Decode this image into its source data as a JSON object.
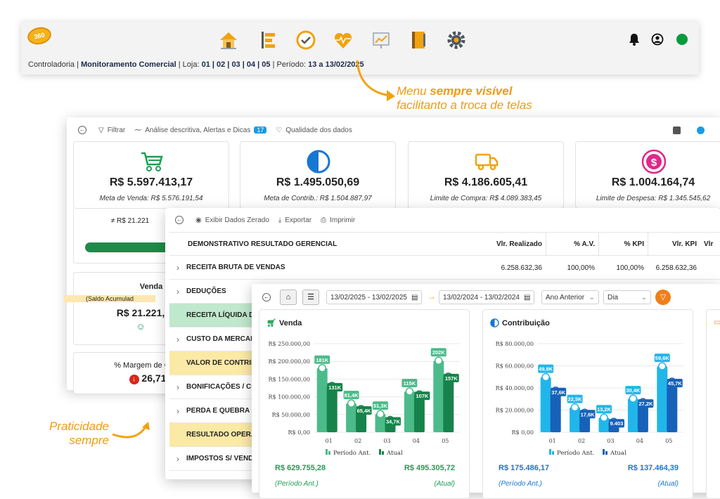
{
  "topbar": {
    "logo_text": "360",
    "breadcrumb": {
      "p1": "Controladoria | ",
      "p2": "Monitoramento Comercial",
      "p3": " | Loja: ",
      "p4": "01 | 02 | 03 | 04 | 05",
      "p5": " | Período: ",
      "p6": "13 a 13/02/2025"
    },
    "icons": [
      "home-icon",
      "list-icon",
      "check-circle-icon",
      "heart-pulse-icon",
      "chart-board-icon",
      "notebook-icon",
      "gear-icon"
    ],
    "right_icons": [
      "bell-icon",
      "user-circle-icon",
      "status-dot-icon"
    ],
    "status_color": "#0a9a3e"
  },
  "callouts": {
    "menu_l1a": "Menu ",
    "menu_l1b": "sempre visível",
    "menu_l2": "facilitanto a troca de telas",
    "prat_l1": "Praticidade",
    "prat_l2": "sempre"
  },
  "panel1": {
    "toolbar": {
      "filter": "Filtrar",
      "analysis": "Análise descritiva, Alertas e Dicas",
      "analysis_badge": "17",
      "quality": "Qualidade dos dados"
    },
    "kpis": [
      {
        "value": "R$ 5.597.413,17",
        "meta": "Meta de Venda: R$ 5.576.191,54",
        "icon": "cart-icon",
        "color": "#1e9e55"
      },
      {
        "value": "R$ 1.495.050,69",
        "meta": "Meta de Contrib.: R$ 1.504.887,97",
        "icon": "half-circle-icon",
        "color": "#1877d2"
      },
      {
        "value": "R$ 4.186.605,41",
        "meta": "Limite de Compra: R$ 4.089.383,45",
        "icon": "truck-icon",
        "color": "#f2a20f"
      },
      {
        "value": "R$ 1.004.164,74",
        "meta": "Limite de Despesa: R$ 1.345.545,62",
        "icon": "dollar-coin-icon",
        "color": "#e0288a"
      }
    ],
    "diff": "≠ R$ 21.221",
    "venda": {
      "title": "Venda",
      "saldo": "(Saldo Acumulad",
      "value": "R$ 21.221,"
    },
    "margem": {
      "title": "% Margem de Co",
      "value": "26,71"
    }
  },
  "panel2": {
    "toolbar": {
      "show_zero": "Exibir Dados Zerado",
      "export": "Exportar",
      "print": "Imprimir"
    },
    "table": {
      "header": "DEMONSTRATIVO RESULTADO GERENCIAL",
      "cols": [
        "Vlr. Realizado",
        "% A.V.",
        "% KPI",
        "Vlr. KPI",
        "Vlr"
      ],
      "rows": [
        {
          "label": "RECEITA BRUTA DE VENDAS",
          "v1": "6.258.632,36",
          "v2": "100,00%",
          "v3": "100,00%",
          "v4": "6.258.632,36"
        },
        {
          "label": "DEDUÇÕES"
        },
        {
          "label": "RECEITA LÍQUIDA D"
        },
        {
          "label": "CUSTO DA MERCADO"
        },
        {
          "label": "VALOR DE CONTRIB"
        },
        {
          "label": "BONIFICAÇÕES / CO"
        },
        {
          "label": "PERDA E QUEBRA"
        },
        {
          "label": "RESULTADO OPERAC"
        },
        {
          "label": "IMPOSTOS S/ VENDA"
        }
      ]
    }
  },
  "panel3": {
    "range1": "13/02/2025 - 13/02/2025",
    "range2": "13/02/2024 - 13/02/2024",
    "compare": "Ano Anterior",
    "granularity": "Dia",
    "cards": [
      {
        "title": "Venda",
        "total_prev": "R$ 629.755,28",
        "total_curr": "R$ 495.305,72",
        "prev_label": "(Período Ant.)",
        "curr_label": "(Atual)"
      },
      {
        "title": "Contribuição",
        "total_prev": "R$ 175.486,17",
        "total_curr": "R$ 137.464,39",
        "prev_label": "(Período Ant.)",
        "curr_label": "(Atual)"
      }
    ]
  },
  "chart_data": [
    {
      "type": "bar",
      "title": "Venda",
      "categories": [
        "01",
        "02",
        "03",
        "04",
        "05"
      ],
      "yticks": [
        "R$ 250.000,00",
        "R$ 200.000,00",
        "R$ 150.000,00",
        "R$ 100.000,00",
        "R$ 50.000,00",
        "R$ 0,00"
      ],
      "ylim": [
        0,
        250000
      ],
      "series": [
        {
          "name": "Período Ant.",
          "values": [
            181000,
            81400,
            51300,
            115000,
            202000
          ],
          "labels": [
            "181K",
            "81,4K",
            "51,3K",
            "115K",
            "202K"
          ],
          "color": "#4cbb8a"
        },
        {
          "name": "Atual",
          "values": [
            131000,
            65400,
            34700,
            107000,
            157000
          ],
          "labels": [
            "131K",
            "65,4K",
            "34,7K",
            "107K",
            "157K"
          ],
          "color": "#16844a"
        }
      ]
    },
    {
      "type": "bar",
      "title": "Contribuição",
      "categories": [
        "01",
        "02",
        "03",
        "04",
        "05"
      ],
      "yticks": [
        "R$ 80.000,00",
        "R$ 60.000,00",
        "R$ 40.000,00",
        "R$ 20.000,00",
        "R$ 0,00"
      ],
      "ylim": [
        0,
        80000
      ],
      "series": [
        {
          "name": "Período Ant.",
          "values": [
            49800,
            22500,
            13200,
            30400,
            59600
          ],
          "labels": [
            "49,8K",
            "22,5K",
            "13,2K",
            "30,4K",
            "59,6K"
          ],
          "color": "#21b6ea"
        },
        {
          "name": "Atual",
          "values": [
            37600,
            17600,
            9403,
            27200,
            45700
          ],
          "labels": [
            "37,6K",
            "17,6K",
            "9.403",
            "27,2K",
            "45,7K"
          ],
          "color": "#1762b8"
        }
      ]
    }
  ]
}
